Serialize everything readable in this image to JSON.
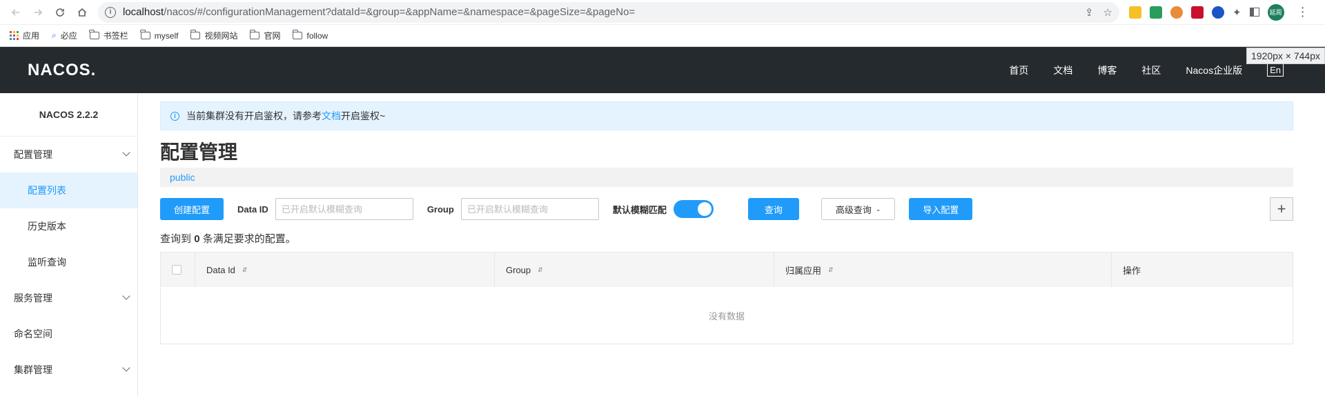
{
  "browser": {
    "url_host": "localhost",
    "url_path": "/nacos/#/configurationManagement?dataId=&group=&appName=&namespace=&pageSize=&pageNo=",
    "avatar_text": "延周"
  },
  "bookmarks": [
    {
      "label": "应用",
      "icon": "apps-icon"
    },
    {
      "label": "必应",
      "icon": "search-icon"
    },
    {
      "label": "书签栏",
      "icon": "folder-icon"
    },
    {
      "label": "myself",
      "icon": "folder-icon"
    },
    {
      "label": "视频网站",
      "icon": "folder-icon"
    },
    {
      "label": "官网",
      "icon": "folder-icon"
    },
    {
      "label": "follow",
      "icon": "folder-icon"
    }
  ],
  "header": {
    "logo": "NACOS.",
    "nav": [
      "首页",
      "文档",
      "博客",
      "社区",
      "Nacos企业版"
    ],
    "lang": "En",
    "size_tip": "1920px × 744px"
  },
  "sidebar": {
    "version": "NACOS 2.2.2",
    "items": [
      {
        "label": "配置管理"
      },
      {
        "label": "配置列表"
      },
      {
        "label": "历史版本"
      },
      {
        "label": "监听查询"
      },
      {
        "label": "服务管理"
      },
      {
        "label": "命名空间"
      },
      {
        "label": "集群管理"
      }
    ]
  },
  "notice": {
    "before": "当前集群没有开启鉴权，请参考",
    "link": "文档",
    "after": "开启鉴权~"
  },
  "page": {
    "title": "配置管理",
    "namespace": "public"
  },
  "query": {
    "create_btn": "创建配置",
    "dataid_label": "Data ID",
    "dataid_placeholder": "已开启默认模糊查询",
    "group_label": "Group",
    "group_placeholder": "已开启默认模糊查询",
    "fuzzy_label": "默认模糊匹配",
    "search_btn": "查询",
    "advanced_btn": "高级查询",
    "import_btn": "导入配置",
    "plus": "+"
  },
  "result": {
    "prefix": "查询到",
    "count": "0",
    "suffix": "条满足要求的配置。"
  },
  "table": {
    "columns": [
      "Data Id",
      "Group",
      "归属应用",
      "操作"
    ],
    "empty_text": "没有数据"
  }
}
